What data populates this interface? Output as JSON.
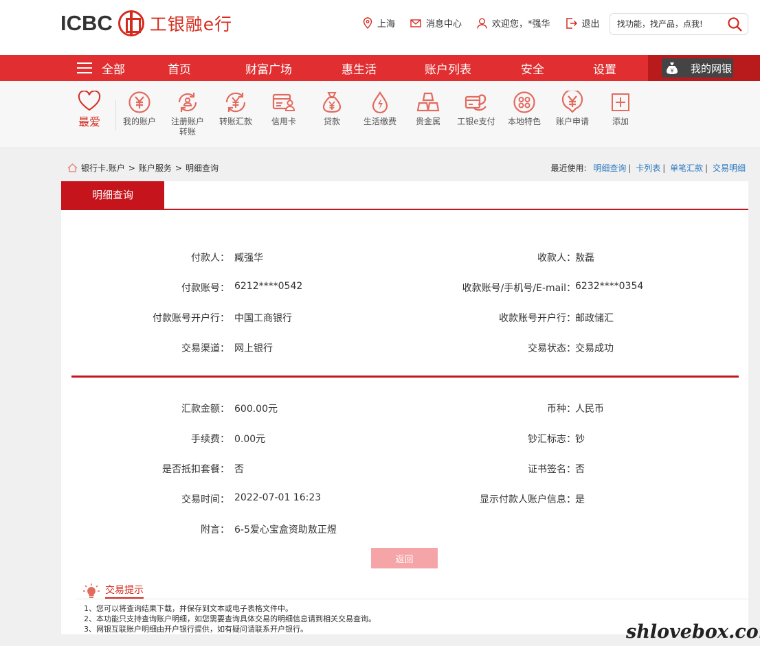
{
  "header": {
    "logo_text": "ICBC",
    "logo_cn": "工银融e行",
    "city": "上海",
    "messages": "消息中心",
    "welcome": "欢迎您，*强华",
    "logout": "退出",
    "search_placeholder": "找功能，找产品，点我!"
  },
  "nav": {
    "all": "全部",
    "items": [
      "首页",
      "财富广场",
      "惠生活",
      "账户列表",
      "安全",
      "设置"
    ],
    "mine": "我的网银"
  },
  "quickbar": {
    "fav": "最爱",
    "items": [
      {
        "label": "我的账户",
        "icon": "yuan-circle-icon"
      },
      {
        "label": "注册账户转账",
        "icon": "register-transfer-icon"
      },
      {
        "label": "转账汇款",
        "icon": "transfer-icon"
      },
      {
        "label": "信用卡",
        "icon": "credit-card-icon"
      },
      {
        "label": "贷款",
        "icon": "loan-bag-icon"
      },
      {
        "label": "生活缴费",
        "icon": "utility-drop-icon"
      },
      {
        "label": "贵金属",
        "icon": "gold-bars-icon"
      },
      {
        "label": "工银e支付",
        "icon": "epay-icon"
      },
      {
        "label": "本地特色",
        "icon": "local-icon"
      },
      {
        "label": "账户申请",
        "icon": "account-apply-icon"
      },
      {
        "label": "添加",
        "icon": "add-icon"
      }
    ]
  },
  "breadcrumb": {
    "items": [
      "银行卡.账户",
      "账户服务",
      "明细查询"
    ],
    "sep": ">"
  },
  "recent": {
    "label": "最近使用:",
    "links": [
      "明细查询",
      "卡列表",
      "单笔汇款",
      "交易明细"
    ]
  },
  "panel": {
    "tab": "明细查询",
    "section1": [
      {
        "left_label": "付款人：",
        "left_value": "臧强华",
        "right_label": "收款人：",
        "right_value": "敖磊"
      },
      {
        "left_label": "付款账号：",
        "left_value": "6212****0542",
        "right_label": "收款账号/手机号/E-mail：",
        "right_value": "6232****0354"
      },
      {
        "left_label": "付款账号开户行：",
        "left_value": "中国工商银行",
        "right_label": "收款账号开户行：",
        "right_value": "邮政储汇"
      },
      {
        "left_label": "交易渠道：",
        "left_value": "网上银行",
        "right_label": "交易状态：",
        "right_value": "交易成功"
      }
    ],
    "section2": [
      {
        "left_label": "汇款金额：",
        "left_value": "600.00元",
        "right_label": "币种：",
        "right_value": "人民币"
      },
      {
        "left_label": "手续费：",
        "left_value": "0.00元",
        "right_label": "钞汇标志：",
        "right_value": "钞"
      },
      {
        "left_label": "是否抵扣套餐：",
        "left_value": "否",
        "right_label": "证书签名：",
        "right_value": "否"
      },
      {
        "left_label": "交易时间：",
        "left_value": "2022-07-01 16:23",
        "right_label": "显示付款人账户信息：",
        "right_value": "是"
      }
    ],
    "memo_label": "附言：",
    "memo_value": "6-5爱心宝盒资助敖正煜",
    "return_button": "返回"
  },
  "tips": {
    "title": "交易提示",
    "lines": [
      "1、您可以将查询结果下载，并保存到文本或电子表格文件中。",
      "2、本功能只支持查询账户明细，如您需要查询具体交易的明细信息请到相关交易查询。",
      "3、网银互联账户明细由开户银行提供，如有疑问请联系开户银行。"
    ]
  },
  "watermark": "shlovebox.com",
  "colors": {
    "brand_red": "#e12e30",
    "dark_red": "#c5141b",
    "link_blue": "#2e7ac0"
  }
}
